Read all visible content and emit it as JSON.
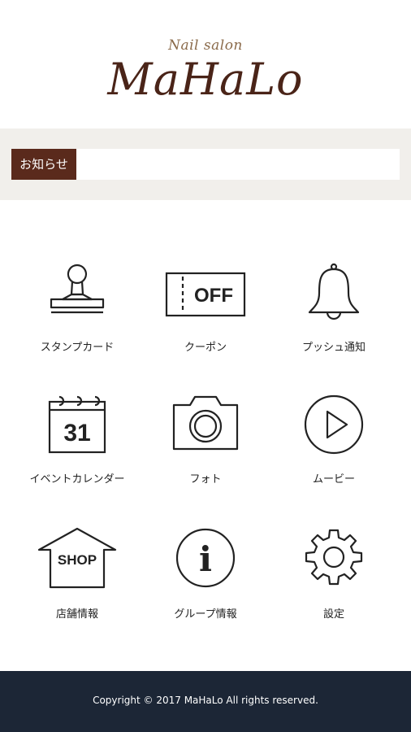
{
  "logo": {
    "subtitle": "Nail salon",
    "title": "MaHaLo"
  },
  "notice": {
    "label": "お知らせ"
  },
  "menu": {
    "items": [
      {
        "label": "スタンプカード",
        "icon": "stamp-icon"
      },
      {
        "label": "クーポン",
        "icon": "coupon-icon",
        "icon_text": "OFF"
      },
      {
        "label": "プッシュ通知",
        "icon": "bell-icon"
      },
      {
        "label": "イベントカレンダー",
        "icon": "calendar-icon",
        "icon_text": "31"
      },
      {
        "label": "フォト",
        "icon": "camera-icon"
      },
      {
        "label": "ムービー",
        "icon": "play-icon"
      },
      {
        "label": "店舗情報",
        "icon": "shop-icon",
        "icon_text": "SHOP"
      },
      {
        "label": "グループ情報",
        "icon": "info-icon",
        "icon_text": "i"
      },
      {
        "label": "設定",
        "icon": "gear-icon"
      }
    ]
  },
  "footer": {
    "copyright": "Copyright © 2017 MaHaLo All rights reserved."
  },
  "colors": {
    "brand": "#5a2a1c",
    "footer_bg": "#1c2636",
    "notice_bg": "#f1efeb"
  }
}
